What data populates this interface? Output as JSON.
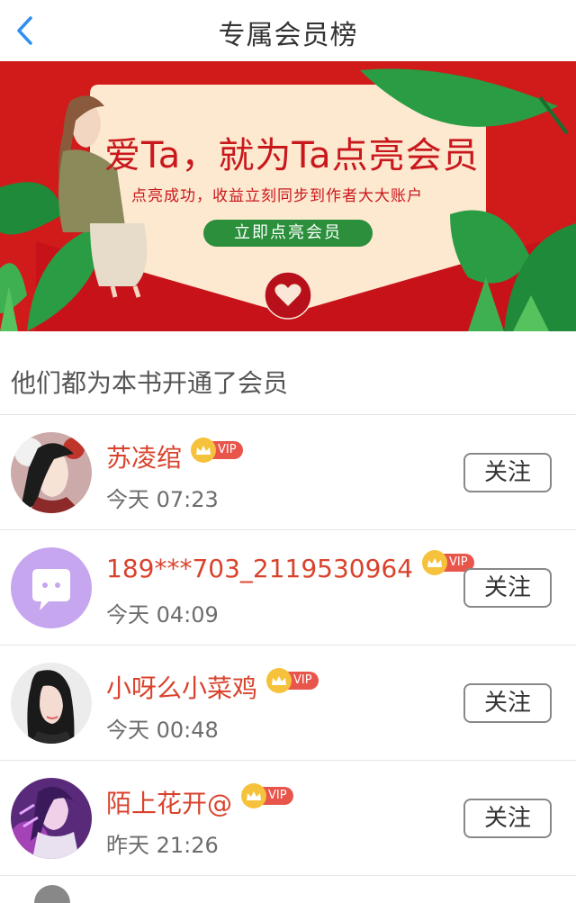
{
  "header": {
    "title": "专属会员榜",
    "back_icon": "chevron-left-icon",
    "accent": "#2f8ff0"
  },
  "banner": {
    "headline": "爱Ta，就为Ta点亮会员",
    "subtitle": "点亮成功，收益立刻同步到作者大大账户",
    "cta": "立即点亮会员",
    "bg_color": "#d11a1a"
  },
  "section": {
    "title": "他们都为本书开通了会员"
  },
  "members": [
    {
      "name": "苏凌绾",
      "vip": "VIP",
      "time": "今天 07:23",
      "follow": "关注",
      "avatar": "illustrated-girl-avatar"
    },
    {
      "name": "189***703_2119530964",
      "vip": "VIP",
      "time": "今天 04:09",
      "follow": "关注",
      "avatar": "default-chat-avatar"
    },
    {
      "name": "小呀么小菜鸡",
      "vip": "VIP",
      "time": "今天 00:48",
      "follow": "关注",
      "avatar": "girl-portrait-avatar"
    },
    {
      "name": "陌上花开@",
      "vip": "VIP",
      "time": "昨天 21:26",
      "follow": "关注",
      "avatar": "purple-anime-avatar"
    }
  ]
}
